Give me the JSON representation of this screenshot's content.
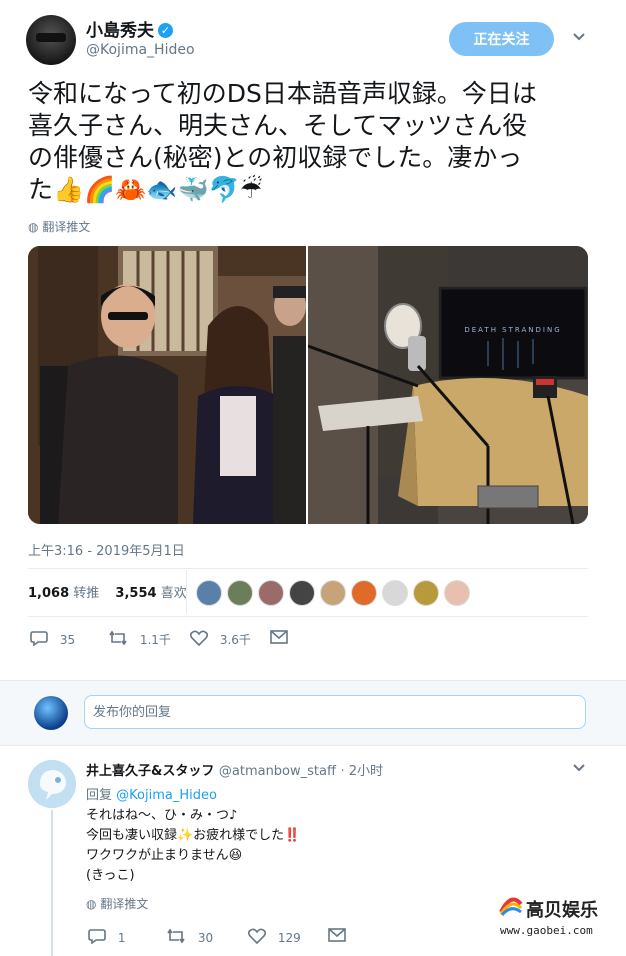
{
  "author": {
    "name": "小島秀夫",
    "handle": "@Kojima_Hideo",
    "follow_label": "正在关注"
  },
  "tweet": {
    "text": "令和になって初のDS日本語音声収録。今日は\n喜久子さん、明夫さん、そしてマッツさん役\nの俳優さん(秘密)との初収録でした。凄かっ\nた👍🌈🦀🐟🐳🐬☔",
    "translate_label": "翻译推文",
    "monitor_text": "DEATH STRANDING",
    "timestamp": "上午3:16 - 2019年5月1日",
    "retweets_count": "1,068",
    "retweets_label": "转推",
    "likes_count": "3,554",
    "likes_label": "喜欢",
    "reply_count": "35",
    "retweet_action_count": "1.1千",
    "like_action_count": "3.6千"
  },
  "liker_colors": [
    "#5a7fa8",
    "#6b7d5a",
    "#9b6b6b",
    "#444444",
    "#c7a37a",
    "#e06a2a",
    "#d8d8d8",
    "#b89a3a",
    "#e8c0b0"
  ],
  "reply_box": {
    "placeholder": "发布你的回复"
  },
  "reply": {
    "name": "井上喜久子&スタッフ",
    "handle": "@atmanbow_staff",
    "time": "· 2小时",
    "replying_to_label": "回复",
    "replying_to_mention": "@Kojima_Hideo",
    "text": "それはね〜、ひ・み・つ♪\n今回も凄い収録✨お疲れ様でした‼️\nワクワクが止まりません😆\n(きっこ)",
    "translate_label": "翻译推文",
    "reply_count": "1",
    "retweet_count": "30",
    "like_count": "129"
  },
  "watermark": {
    "title": "高贝娱乐",
    "url": "www.gaobei.com"
  },
  "colors": {
    "accent": "#1da1f2",
    "follow_button": "#7fc1f5",
    "muted_text": "#657786"
  }
}
